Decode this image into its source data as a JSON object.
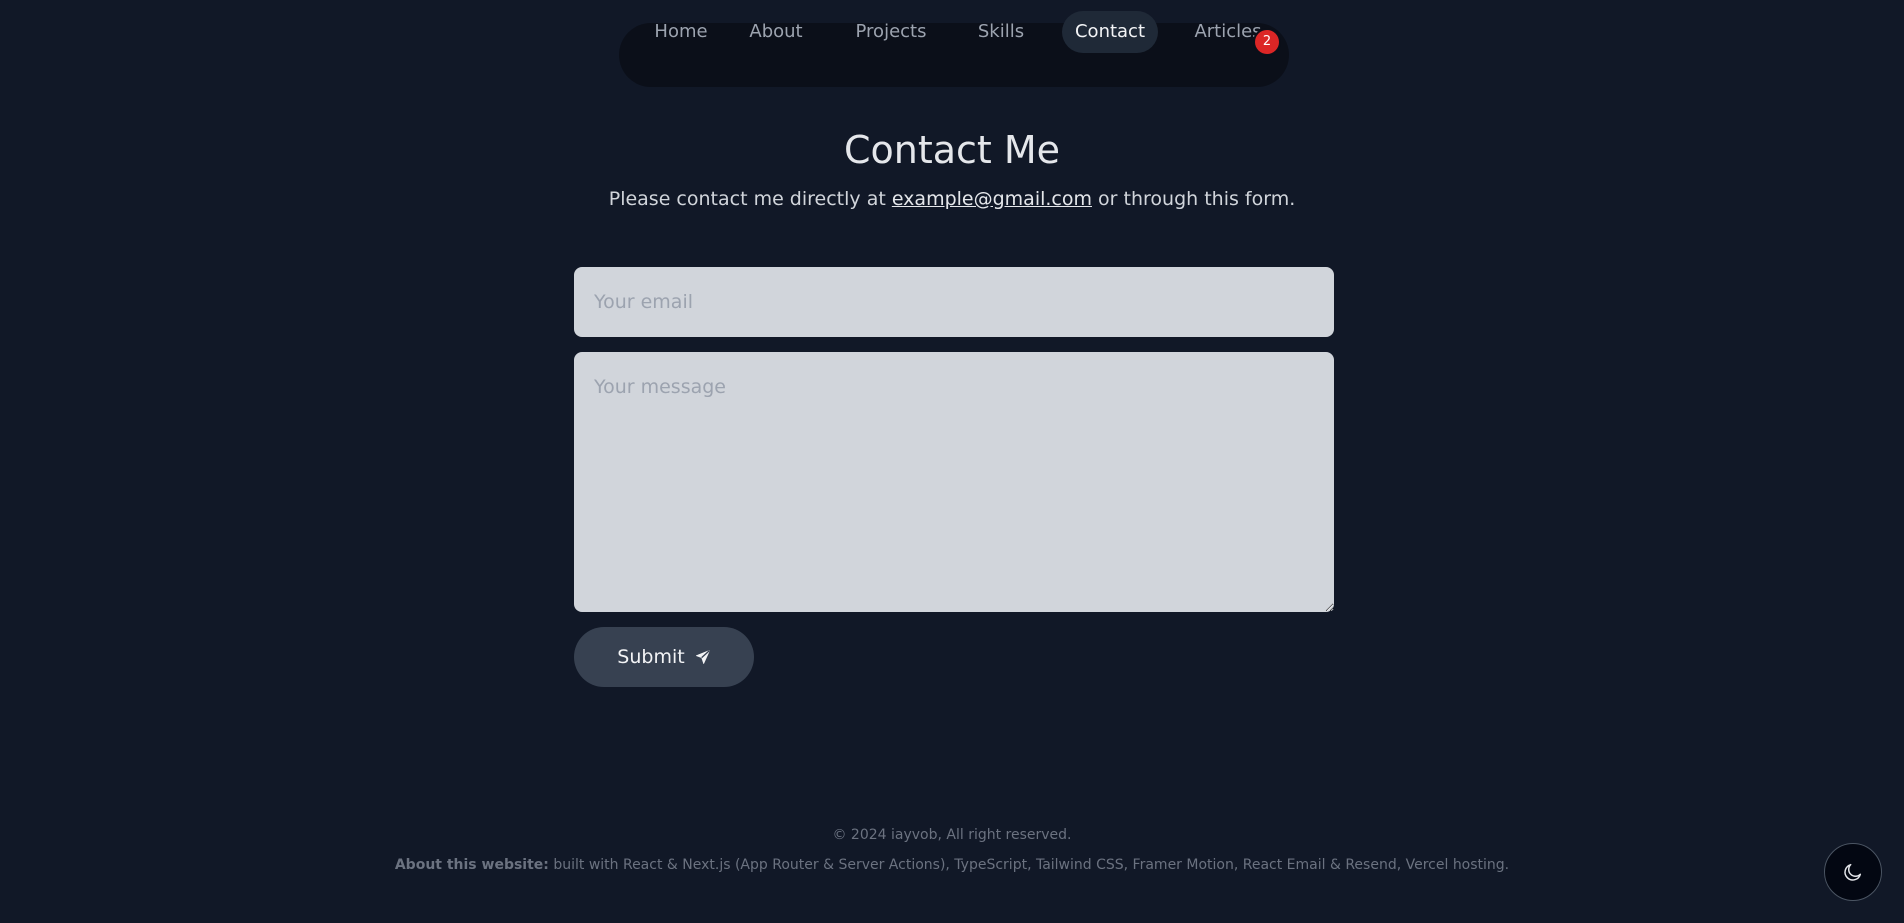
{
  "nav": {
    "items": [
      {
        "label": "Home"
      },
      {
        "label": "About"
      },
      {
        "label": "Projects"
      },
      {
        "label": "Skills"
      },
      {
        "label": "Contact"
      },
      {
        "label": "Articles"
      }
    ],
    "active": "Contact",
    "articles_badge": "2"
  },
  "contact": {
    "title": "Contact Me",
    "intro_before": "Please contact me directly at ",
    "email_link": "example@gmail.com",
    "intro_after": " or through this form.",
    "email_placeholder": "Your email",
    "email_value": "",
    "message_placeholder": "Your message",
    "message_value": "",
    "submit_label": "Submit",
    "submit_icon": "paper-plane-icon"
  },
  "footer": {
    "copyright": "© 2024 iayvob, All right reserved.",
    "about_label": "About this website:",
    "about_text": " built with React & Next.js (App Router & Server Actions), TypeScript, Tailwind CSS, Framer Motion, React Email & Resend, Vercel hosting."
  },
  "theme_toggle": {
    "icon": "moon-icon"
  },
  "colors": {
    "background": "#111827",
    "nav_background": "#0b0f19",
    "active_pill": "#1f2937",
    "input_background": "#d1d5db",
    "button_background": "#374151",
    "badge": "#dc2626"
  }
}
